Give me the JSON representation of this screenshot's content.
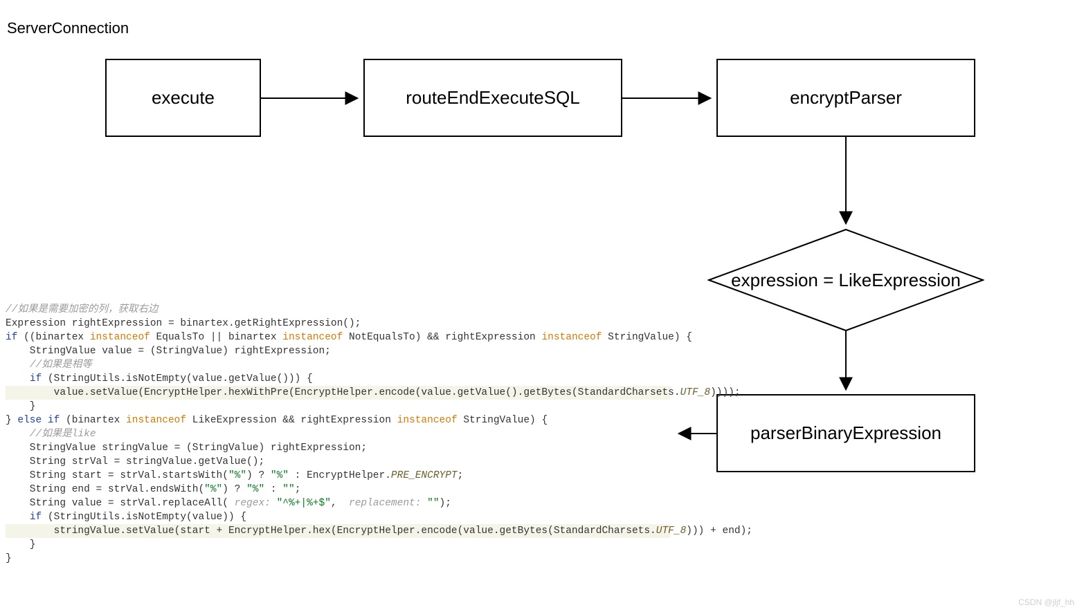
{
  "title": "ServerConnection",
  "nodes": {
    "execute": "execute",
    "routeEndExecuteSQL": "routeEndExecuteSQL",
    "encryptParser": "encryptParser",
    "decision": "expression = LikeExpression",
    "parserBinaryExpression": "parserBinaryExpression"
  },
  "code": {
    "lines": [
      {
        "hl": false,
        "html": "<span class='cm'>//如果是需要加密的列，获取右边</span>"
      },
      {
        "hl": false,
        "html": "Expression rightExpression = binartex.getRightExpression();"
      },
      {
        "hl": false,
        "html": "<span class='kw'>if</span> ((binartex <span class='or'>instanceof</span> EqualsTo || binartex <span class='or'>instanceof</span> NotEqualsTo) &amp;&amp; rightExpression <span class='or'>instanceof</span> StringValue) {"
      },
      {
        "hl": false,
        "html": "    StringValue value = (StringValue) rightExpression;"
      },
      {
        "hl": false,
        "html": "    <span class='cm'>//如果是相等</span>"
      },
      {
        "hl": false,
        "html": "    <span class='kw'>if</span> (StringUtils.isNotEmpty(value.getValue())) {"
      },
      {
        "hl": true,
        "html": "        value.setValue(EncryptHelper.hexWithPre(EncryptHelper.encode(value.getValue().getBytes(StandardCharsets.<span class='it'>UTF_8</span>))));"
      },
      {
        "hl": false,
        "html": "    }"
      },
      {
        "hl": false,
        "html": "} <span class='kw'>else if</span> (binartex <span class='or'>instanceof</span> LikeExpression &amp;&amp; rightExpression <span class='or'>instanceof</span> StringValue) {"
      },
      {
        "hl": false,
        "html": "    <span class='cm'>//如果是like</span>"
      },
      {
        "hl": false,
        "html": "    StringValue stringValue = (StringValue) rightExpression;"
      },
      {
        "hl": false,
        "html": "    String strVal = stringValue.getValue();"
      },
      {
        "hl": false,
        "html": "    String start = strVal.startsWith(<span class='str'>\"%\"</span>) ? <span class='str'>\"%\"</span> : EncryptHelper.<span class='it'>PRE_ENCRYPT</span>;"
      },
      {
        "hl": false,
        "html": "    String end = strVal.endsWith(<span class='str'>\"%\"</span>) ? <span class='str'>\"%\"</span> : <span class='str'>\"\"</span>;"
      },
      {
        "hl": false,
        "html": "    String value = strVal.replaceAll( <span class='ph'>regex:</span> <span class='str'>\"^%+|%+$\"</span>,  <span class='ph'>replacement:</span> <span class='str'>\"\"</span>);"
      },
      {
        "hl": false,
        "html": "    <span class='kw'>if</span> (StringUtils.isNotEmpty(value)) {"
      },
      {
        "hl": true,
        "html": "        stringValue.setValue(start + EncryptHelper.hex(EncryptHelper.encode(value.getBytes(StandardCharsets.<span class='it'>UTF_8</span>))) + end);"
      },
      {
        "hl": false,
        "html": "    }"
      },
      {
        "hl": false,
        "html": "}"
      }
    ]
  },
  "watermark": "CSDN @jljf_hh"
}
